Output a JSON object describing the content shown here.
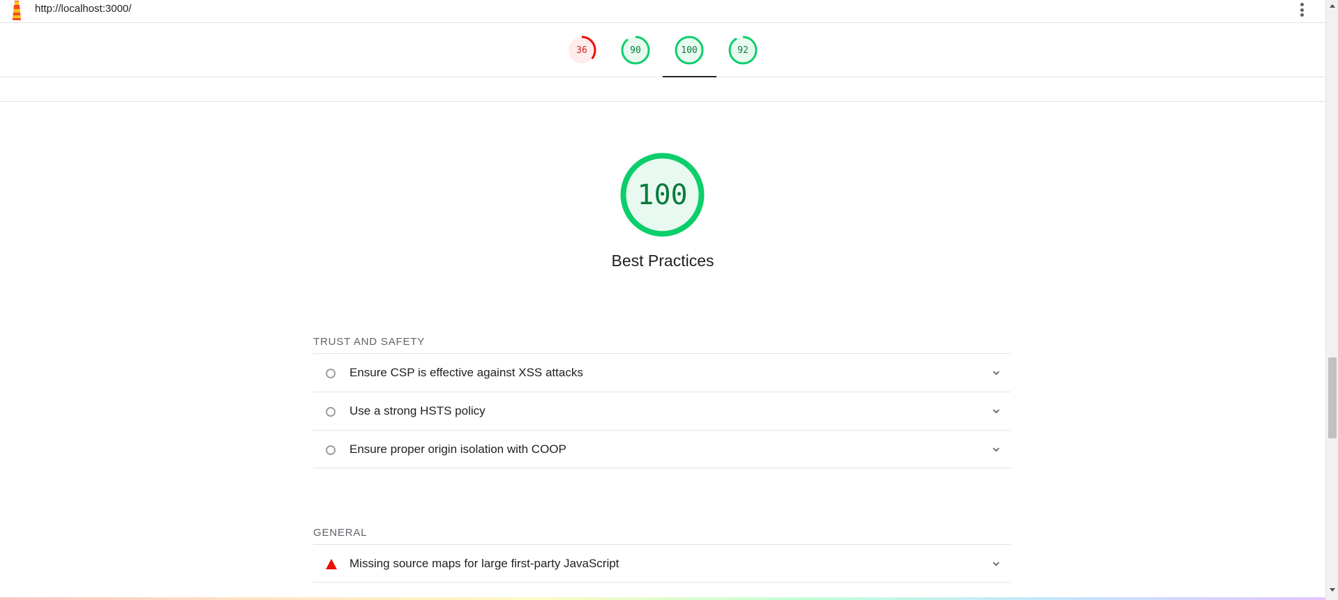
{
  "header": {
    "url": "http://localhost:3000/"
  },
  "category_gauges": [
    {
      "score": "36",
      "color": "#eb0f00",
      "fraction": 0.36
    },
    {
      "score": "90",
      "color": "#0cce6b",
      "fraction": 0.9
    },
    {
      "score": "100",
      "color": "#0cce6b",
      "fraction": 1.0,
      "active": true
    },
    {
      "score": "92",
      "color": "#0cce6b",
      "fraction": 0.92
    }
  ],
  "category": {
    "score": "100",
    "fraction": 1.0,
    "title": "Best Practices",
    "color": "#0cce6b"
  },
  "groups": [
    {
      "title": "TRUST AND SAFETY",
      "audits": [
        {
          "title": "Ensure CSP is effective against XSS attacks",
          "status": "informative"
        },
        {
          "title": "Use a strong HSTS policy",
          "status": "informative"
        },
        {
          "title": "Ensure proper origin isolation with COOP",
          "status": "informative"
        }
      ]
    },
    {
      "title": "GENERAL",
      "audits": [
        {
          "title": "Missing source maps for large first-party JavaScript",
          "status": "fail"
        }
      ]
    }
  ],
  "icons": {
    "logo": "lighthouse-logo-icon",
    "menu": "more-vert-icon",
    "expand": "chevron-down-icon",
    "informative": "circle-outline-icon",
    "fail": "red-triangle-icon"
  }
}
